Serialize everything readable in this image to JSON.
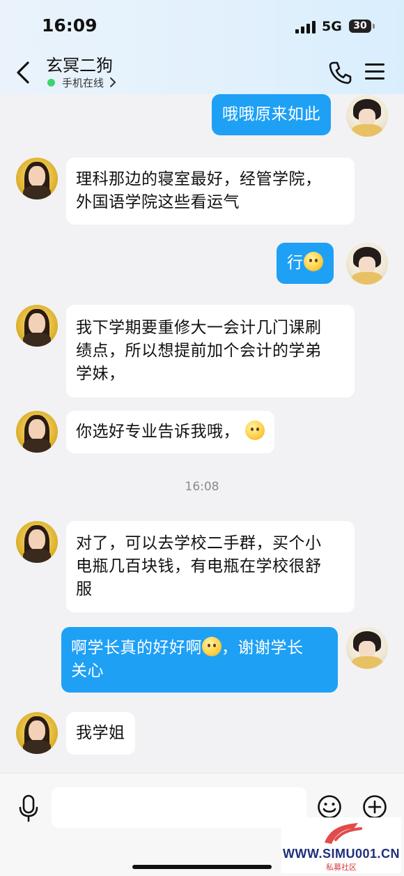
{
  "status_bar": {
    "time": "16:09",
    "network": "5G",
    "battery": "30"
  },
  "header": {
    "contact_name": "玄冥二狗",
    "status": "手机在线"
  },
  "messages": [
    {
      "side": "out",
      "lines": [
        "哦哦原来如此"
      ]
    },
    {
      "side": "in",
      "lines": [
        "理科那边的寝室最好，经管学院，",
        "外国语学院这些看运气"
      ]
    },
    {
      "side": "out",
      "lines": [
        "行"
      ],
      "emoji": "laughing-face-emoji"
    },
    {
      "side": "in",
      "lines": [
        "我下学期要重修大一会计几门课刷",
        "绩点，所以想提前加个会计的学弟",
        "学妹，"
      ]
    },
    {
      "side": "in",
      "lines": [
        "你选好专业告诉我哦，"
      ],
      "emoji": "hugging-face-emoji"
    },
    {
      "side": "in",
      "lines": [
        "对了，可以去学校二手群，买个小",
        "电瓶几百块钱，有电瓶在学校很舒",
        "服"
      ]
    },
    {
      "side": "out",
      "lines": [
        "啊学长真的好好啊",
        "关心"
      ],
      "line1_tail": "，谢谢学长",
      "emoji": "starstruck-face-emoji"
    },
    {
      "side": "in",
      "lines": [
        "我学姐"
      ]
    }
  ],
  "timestamp": "16:08",
  "watermark": {
    "url": "WWW.SIMU001.CN",
    "sub": "私募社区"
  },
  "colors": {
    "outgoing_bubble": "#1ea0f5",
    "incoming_bubble": "#ffffff",
    "background": "#f2f2f4",
    "online_dot": "#3ed36f"
  }
}
